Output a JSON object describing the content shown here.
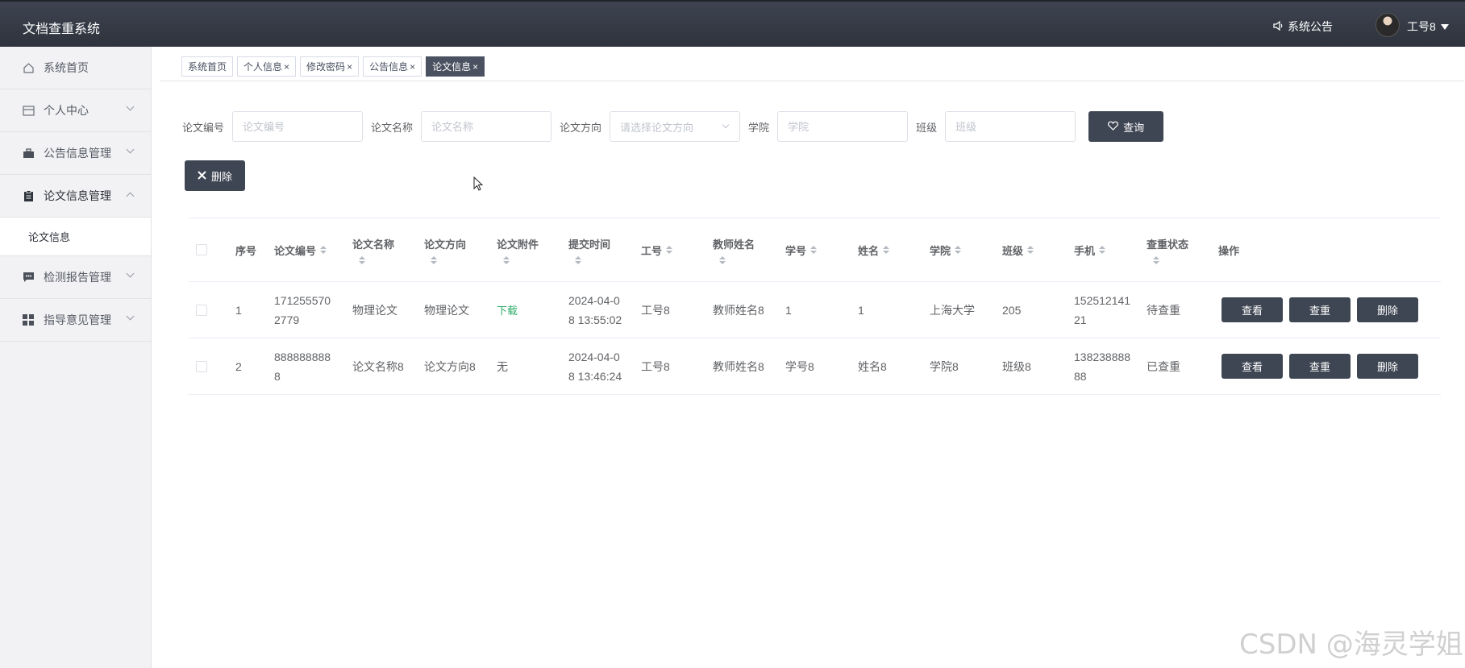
{
  "header": {
    "app_title": "文档查重系统",
    "notice_label": "系统公告",
    "user_name": "工号8"
  },
  "sidebar": {
    "items": [
      {
        "label": "系统首页",
        "icon": "home-icon",
        "expandable": false
      },
      {
        "label": "个人中心",
        "icon": "card-icon",
        "expandable": true
      },
      {
        "label": "公告信息管理",
        "icon": "briefcase-icon",
        "expandable": true
      },
      {
        "label": "论文信息管理",
        "icon": "clipboard-icon",
        "expandable": true,
        "expanded": true
      },
      {
        "label": "检测报告管理",
        "icon": "message-icon",
        "expandable": true
      },
      {
        "label": "指导意见管理",
        "icon": "grid-icon",
        "expandable": true
      }
    ],
    "submenu": {
      "label": "论文信息"
    }
  },
  "tabs": [
    {
      "label": "系统首页",
      "closable": false,
      "active": false
    },
    {
      "label": "个人信息",
      "closable": true,
      "active": false
    },
    {
      "label": "修改密码",
      "closable": true,
      "active": false
    },
    {
      "label": "公告信息",
      "closable": true,
      "active": false
    },
    {
      "label": "论文信息",
      "closable": true,
      "active": true
    }
  ],
  "tab_close_glyph": "×",
  "filters": {
    "paper_no": {
      "label": "论文编号",
      "placeholder": "论文编号"
    },
    "paper_name": {
      "label": "论文名称",
      "placeholder": "论文名称"
    },
    "paper_direction": {
      "label": "论文方向",
      "placeholder": "请选择论文方向"
    },
    "college": {
      "label": "学院",
      "placeholder": "学院"
    },
    "class": {
      "label": "班级",
      "placeholder": "班级"
    },
    "query_label": "查询"
  },
  "actions": {
    "delete_label": "删除"
  },
  "table": {
    "columns": [
      "序号",
      "论文编号",
      "论文名称",
      "论文方向",
      "论文附件",
      "提交时间",
      "工号",
      "教师姓名",
      "学号",
      "姓名",
      "学院",
      "班级",
      "手机",
      "查重状态",
      "操作"
    ],
    "rows": [
      {
        "index": "1",
        "paper_no": [
          "171255570",
          "2779"
        ],
        "paper_name": "物理论文",
        "direction": "物理论文",
        "attachment": "下载",
        "submit_time": [
          "2024-04-0",
          "8 13:55:02"
        ],
        "staff_no": "工号8",
        "teacher": "教师姓名8",
        "student_no": "1",
        "name": "1",
        "college": "上海大学",
        "class": "205",
        "phone": [
          "152512141",
          "21"
        ],
        "status": "待查重"
      },
      {
        "index": "2",
        "paper_no": [
          "888888888",
          "8"
        ],
        "paper_name": "论文名称8",
        "direction": "论文方向8",
        "attachment": "无",
        "submit_time": [
          "2024-04-0",
          "8 13:46:24"
        ],
        "staff_no": "工号8",
        "teacher": "教师姓名8",
        "student_no": "学号8",
        "name": "姓名8",
        "college": "学院8",
        "class": "班级8",
        "phone": [
          "138238888",
          "88"
        ],
        "status": "已查重"
      }
    ],
    "row_actions": [
      "查看",
      "查重",
      "删除"
    ]
  },
  "watermark": "CSDN @海灵学姐"
}
